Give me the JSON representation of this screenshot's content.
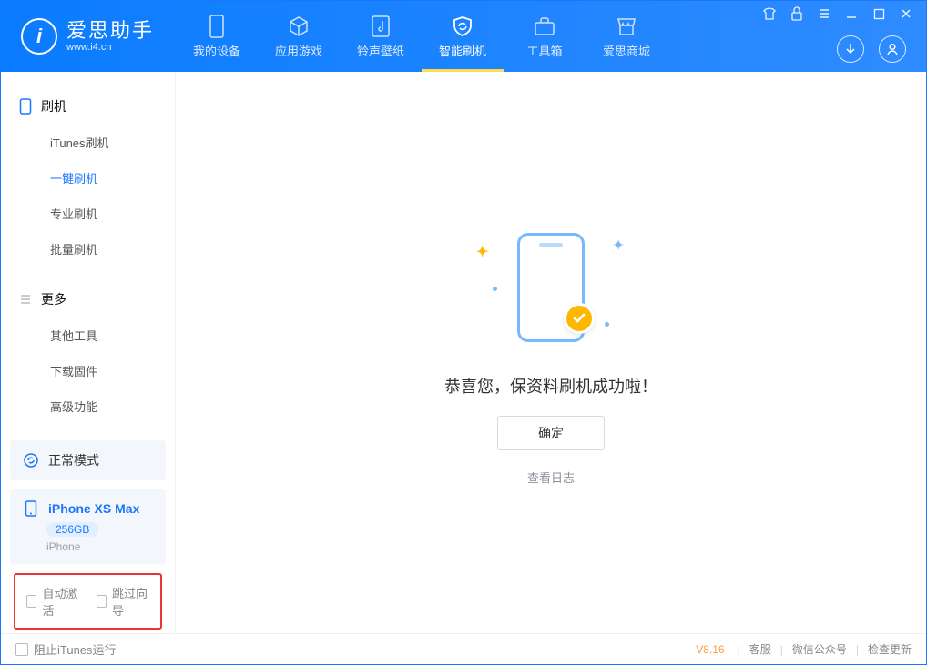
{
  "logo": {
    "name": "爱思助手",
    "domain": "www.i4.cn",
    "glyph": "i"
  },
  "nav": [
    {
      "label": "我的设备"
    },
    {
      "label": "应用游戏"
    },
    {
      "label": "铃声壁纸"
    },
    {
      "label": "智能刷机"
    },
    {
      "label": "工具箱"
    },
    {
      "label": "爱思商城"
    }
  ],
  "sidebar": {
    "section1": {
      "title": "刷机",
      "items": [
        "iTunes刷机",
        "一键刷机",
        "专业刷机",
        "批量刷机"
      ]
    },
    "section2": {
      "title": "更多",
      "items": [
        "其他工具",
        "下载固件",
        "高级功能"
      ]
    }
  },
  "mode": {
    "label": "正常模式"
  },
  "device": {
    "name": "iPhone XS Max",
    "storage": "256GB",
    "type": "iPhone"
  },
  "options": {
    "auto_activate": "自动激活",
    "skip_guide": "跳过向导"
  },
  "result": {
    "message": "恭喜您，保资料刷机成功啦！",
    "ok": "确定",
    "view_log": "查看日志"
  },
  "footer": {
    "stop_itunes": "阻止iTunes运行",
    "version": "V8.16",
    "links": [
      "客服",
      "微信公众号",
      "检查更新"
    ]
  }
}
